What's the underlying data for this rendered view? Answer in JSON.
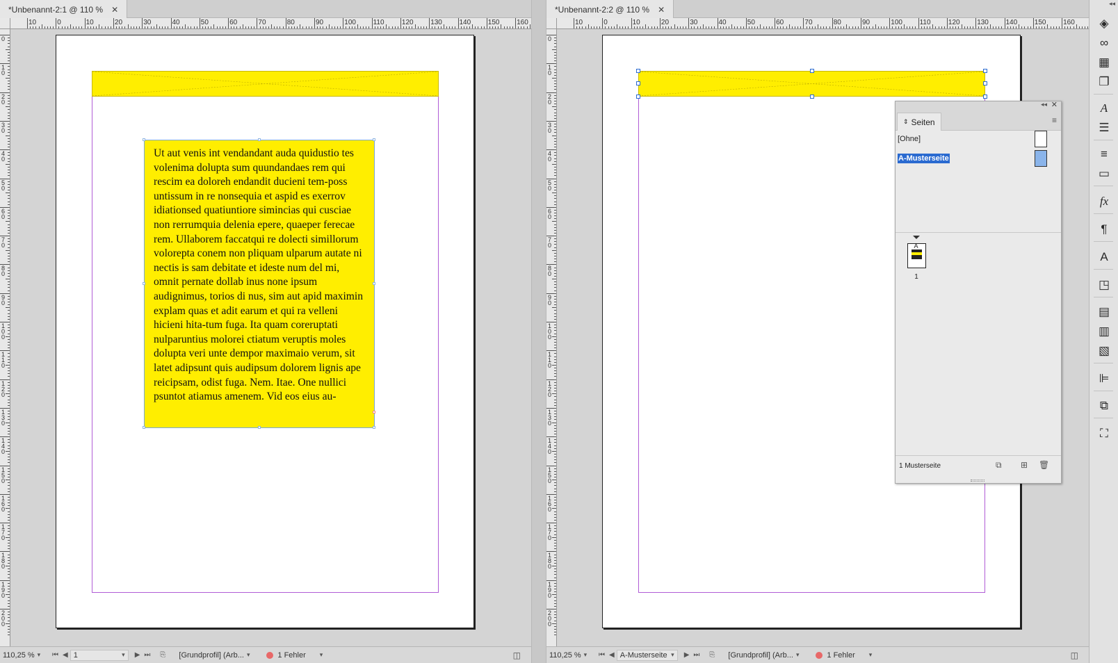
{
  "left_window": {
    "tab_title": "*Unbenannt-2:1 @ 110 %",
    "ruler_h": [
      "10",
      "0",
      "10",
      "20",
      "30",
      "40",
      "50",
      "60",
      "70",
      "80",
      "90",
      "100",
      "110",
      "120",
      "130",
      "140",
      "150",
      "160"
    ],
    "ruler_v": [
      "0",
      "10",
      "20",
      "30",
      "40",
      "50",
      "60",
      "70",
      "80",
      "90",
      "100",
      "110",
      "120",
      "130",
      "140",
      "150",
      "160",
      "170",
      "180",
      "190",
      "200"
    ],
    "body_text": "Ut aut venis int vendandant auda quidustio tes volenima dolupta sum quundandaes rem qui rescim ea doloreh endandit ducieni tem-poss untissum in re nonsequia et aspid es exerrov idiationsed quatiuntiore simincias qui cusciae non rerrumquia delenia epere, quaeper ferecae rem. Ullaborem faccatqui re dolecti simillorum volorepta conem non pliquam ulparum autate ni nectis is sam debitate et ideste num del mi, omnit pernate dollab inus none ipsum audignimus, torios di nus, sim aut apid maximin explam quas et adit earum et qui ra velleni hicieni hita-tum fuga. Ita quam coreruptati nulparuntius molorei ctiatum veruptis moles dolupta veri unte dempor maximaio verum, sit latet adipsunt quis audipsum dolorem lignis ape reicipsam, odist fuga. Nem. Itae. One nullici psuntot atiamus amenem. Vid eos eius au-",
    "status": {
      "zoom": "110,25 %",
      "page": "1",
      "profile": "[Grundprofil] (Arb...",
      "errors": "1 Fehler"
    }
  },
  "right_window": {
    "tab_title": "*Unbenannt-2:2 @ 110 %",
    "ruler_h": [
      "10",
      "0",
      "10",
      "20",
      "30",
      "40",
      "50",
      "60",
      "70",
      "80",
      "90",
      "100",
      "110",
      "120",
      "130",
      "140",
      "150",
      "160"
    ],
    "ruler_v": [
      "0",
      "10",
      "20",
      "30",
      "40",
      "50",
      "60",
      "70",
      "80",
      "90",
      "100",
      "110",
      "120",
      "130",
      "140",
      "150",
      "160",
      "170",
      "180",
      "190",
      "200"
    ],
    "status": {
      "zoom": "110,25 %",
      "page": "A-Musterseite",
      "profile": "[Grundprofil] (Arb...",
      "errors": "1 Fehler"
    }
  },
  "pages_panel": {
    "title": "Seiten",
    "masters": [
      {
        "label": "[Ohne]",
        "selected": false
      },
      {
        "label": "A-Musterseite",
        "selected": true
      }
    ],
    "page_thumb_prefix": "A",
    "page_number": "1",
    "footer_count": "1 Musterseite"
  },
  "colors": {
    "frame_fill": "#ffee00",
    "margin_guide": "#b05cd6",
    "selection": "#2a6ad0",
    "error": "#e86868"
  },
  "tool_icons": [
    "layers-icon",
    "links-icon",
    "swatches-icon",
    "pages-icon",
    "character-styles-icon",
    "paragraph-icon",
    "stroke-icon",
    "gradient-icon",
    "effects-icon",
    "paragraph-styles-icon",
    "character-styles-2-icon",
    "object-styles-icon",
    "table-icon",
    "table-styles-icon",
    "cell-styles-icon",
    "align-icon",
    "pathfinder-icon",
    "transform-icon"
  ]
}
